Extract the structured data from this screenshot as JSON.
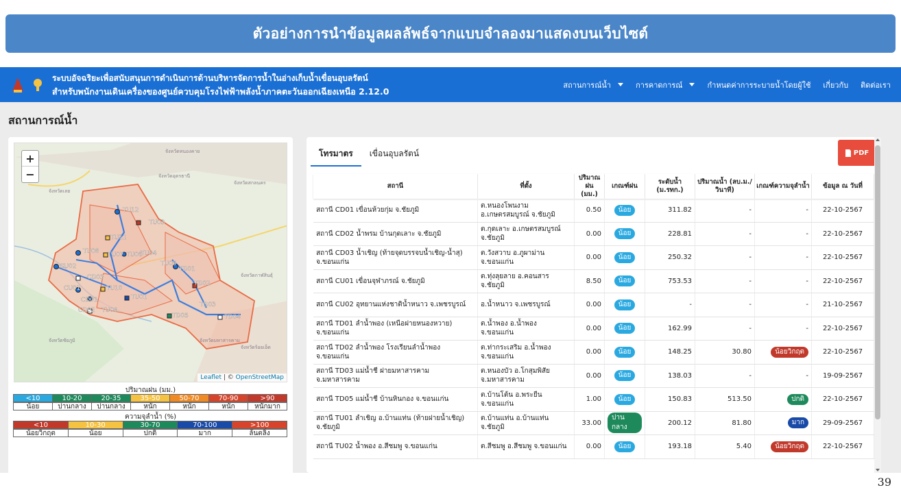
{
  "banner": {
    "title": "ตัวอย่างการนำข้อมูลผลลัพธ์จากแบบจำลองมาแสดงบนเว็บไซต์"
  },
  "navbar": {
    "title_line1": "ระบบอัจฉริยะเพื่อสนับสนุนการดำเนินการด้านบริหารจัดการน้ำในอ่างเก็บน้ำเขื่อนอุบลรัตน์",
    "title_line2": "สำหรับพนักงานเดินเครื่องของศูนย์ควบคุมโรงไฟฟ้าพลังน้ำภาคตะวันออกเฉียงเหนือ 2.12.0",
    "menu": [
      "สถานการณ์น้ำ",
      "การคาดการณ์",
      "กำหนดค่าการระบายน้ำโดยผู้ใช้",
      "เกี่ยวกับ",
      "ติดต่อเรา"
    ]
  },
  "page": {
    "title": "สถานการณ์น้ำ",
    "slide_number": "39"
  },
  "map": {
    "zoom_in": "+",
    "zoom_out": "−",
    "attribution_leaflet": "Leaflet",
    "attribution_sep": " | © ",
    "attribution_osm": "OpenStreetMap",
    "labels": [
      "TU12",
      "TU03",
      "TU11",
      "TU08",
      "TU07",
      "TU06",
      "TU04",
      "CU02",
      "CD03",
      "TU05",
      "TD01",
      "TD02",
      "CU01",
      "TU10",
      "CD01",
      "TU01",
      "TD03",
      "TU09",
      "CD02",
      "TD05",
      "TD04"
    ],
    "place_names": [
      "จังหวัดหนองคาย",
      "จังหวัดเลย",
      "จังหวัดอุดรธานี",
      "จังหวัดสกลนคร",
      "จังหวัดกาฬสินธุ์",
      "จังหวัดชัยภูมิ",
      "จังหวัดมหาสารคาม",
      "จังหวัดร้อยเอ็ด"
    ]
  },
  "legend": {
    "rain_title": "ปริมาณฝน (มม.)",
    "rain_ranges": [
      "<10",
      "10-20",
      "20-35",
      "35-50",
      "50-70",
      "70-90",
      ">90"
    ],
    "rain_labels": [
      "น้อย",
      "ปานกลาง",
      "ปานกลาง",
      "หนัก",
      "หนัก",
      "หนัก",
      "หนักมาก"
    ],
    "rain_colors": [
      "#2aa9e0",
      "#1e8a5c",
      "#1e8a5c",
      "#f5c242",
      "#f08a24",
      "#d6452b",
      "#c0392b"
    ],
    "cap_title": "ความจุลำน้ำ (%)",
    "cap_ranges": [
      "<10",
      "10-30",
      "30-70",
      "70-100",
      ">100"
    ],
    "cap_labels": [
      "น้อยวิกฤต",
      "น้อย",
      "ปกติ",
      "มาก",
      "ล้นตลิ่ง"
    ],
    "cap_colors": [
      "#c0392b",
      "#f5c242",
      "#1e8a5c",
      "#1a4aa8",
      "#d6452b"
    ]
  },
  "tabs": [
    "โทรมาตร",
    "เขื่อนอุบลรัตน์"
  ],
  "pdf_button": "PDF",
  "table": {
    "headers": [
      "สถานี",
      "ที่ตั้ง",
      "ปริมาณฝน (มม.)",
      "เกณฑ์ฝน",
      "ระดับน้ำ (ม.รทก.)",
      "ปริมาณน้ำ (ลบ.ม./วินาที)",
      "เกณฑ์ความจุลำน้ำ",
      "ข้อมูล ณ วันที่"
    ],
    "rows": [
      {
        "station": "สถานี CD01 เขื่อนห้วยกุ่ม จ.ชัยภูมิ",
        "location": "ต.หนองโพนงาม อ.เกษตรสมบูรณ์ จ.ชัยภูมิ",
        "rain": "0.50",
        "rain_level": "น้อย",
        "rain_color": "#2aa9e0",
        "level": "311.82",
        "flow": "-",
        "cap": "-",
        "cap_color": "",
        "date": "22-10-2567"
      },
      {
        "station": "สถานี CD02 น้ำพรม บ้านกุดเลาะ จ.ชัยภูมิ",
        "location": "ต.กุดเลาะ อ.เกษตรสมบูรณ์ จ.ชัยภูมิ",
        "rain": "0.00",
        "rain_level": "น้อย",
        "rain_color": "#2aa9e0",
        "level": "228.81",
        "flow": "-",
        "cap": "-",
        "cap_color": "",
        "date": "22-10-2567"
      },
      {
        "station": "สถานี CD03 น้ำเชิญ (ท้ายจุดบรรจบน้ำเชิญ-น้ำสุ) จ.ขอนแก่น",
        "location": "ต.วังสวาบ อ.ภูผาม่าน จ.ขอนแก่น",
        "rain": "0.00",
        "rain_level": "น้อย",
        "rain_color": "#2aa9e0",
        "level": "250.32",
        "flow": "-",
        "cap": "-",
        "cap_color": "",
        "date": "22-10-2567"
      },
      {
        "station": "สถานี CU01 เขื่อนจุฬาภรณ์ จ.ชัยภูมิ",
        "location": "ต.ทุ่งลุยลาย อ.คอนสาร จ.ชัยภูมิ",
        "rain": "8.50",
        "rain_level": "น้อย",
        "rain_color": "#2aa9e0",
        "level": "753.53",
        "flow": "-",
        "cap": "-",
        "cap_color": "",
        "date": "22-10-2567"
      },
      {
        "station": "สถานี CU02 อุทยานแห่งชาติน้ำหนาว จ.เพชรบูรณ์",
        "location": "อ.น้ำหนาว จ.เพชรบูรณ์",
        "rain": "0.00",
        "rain_level": "น้อย",
        "rain_color": "#2aa9e0",
        "level": "-",
        "flow": "-",
        "cap": "-",
        "cap_color": "",
        "date": "21-10-2567"
      },
      {
        "station": "สถานี TD01 ลำน้ำพอง (เหนือฝายหนองหวาย) จ.ขอนแก่น",
        "location": "ต.น้ำพอง อ.น้ำพอง จ.ขอนแก่น",
        "rain": "0.00",
        "rain_level": "น้อย",
        "rain_color": "#2aa9e0",
        "level": "162.99",
        "flow": "-",
        "cap": "-",
        "cap_color": "",
        "date": "22-10-2567"
      },
      {
        "station": "สถานี TD02 ลำน้ำพอง โรงเรียนลำน้ำพอง จ.ขอนแก่น",
        "location": "ต.ท่ากระเสริม อ.น้ำพอง จ.ขอนแก่น",
        "rain": "0.00",
        "rain_level": "น้อย",
        "rain_color": "#2aa9e0",
        "level": "148.25",
        "flow": "30.80",
        "cap": "น้อยวิกฤต",
        "cap_color": "#c0392b",
        "date": "22-10-2567"
      },
      {
        "station": "สถานี TD03 แม่น้ำชี ฝายมหาสารคาม จ.มหาสารคาม",
        "location": "ต.หนองบัว อ.โกสุมพิสัย จ.มหาสารคาม",
        "rain": "0.00",
        "rain_level": "น้อย",
        "rain_color": "#2aa9e0",
        "level": "138.03",
        "flow": "-",
        "cap": "-",
        "cap_color": "",
        "date": "19-09-2567"
      },
      {
        "station": "สถานี TD05 แม่น้ำชี บ้านหินกอง จ.ขอนแก่น",
        "location": "ต.บ้านโต้น อ.พระยืน จ.ขอนแก่น",
        "rain": "1.00",
        "rain_level": "น้อย",
        "rain_color": "#2aa9e0",
        "level": "150.83",
        "flow": "513.50",
        "cap": "ปกติ",
        "cap_color": "#1e8a5c",
        "date": "22-10-2567"
      },
      {
        "station": "สถานี TU01 ลำเชิญ อ.บ้านแท่น (ท้ายฝายน้ำเชิญ) จ.ชัยภูมิ",
        "location": "ต.บ้านแท่น อ.บ้านแท่น จ.ชัยภูมิ",
        "rain": "33.00",
        "rain_level": "ปานกลาง",
        "rain_color": "#1e8a5c",
        "level": "200.12",
        "flow": "81.80",
        "cap": "มาก",
        "cap_color": "#1a4aa8",
        "date": "29-09-2567"
      },
      {
        "station": "สถานี TU02 น้ำพอง อ.สีชมพู จ.ขอนแก่น",
        "location": "ต.สีชมพู อ.สีชมพู จ.ขอนแก่น",
        "rain": "0.00",
        "rain_level": "น้อย",
        "rain_color": "#2aa9e0",
        "level": "193.18",
        "flow": "5.40",
        "cap": "น้อยวิกฤต",
        "cap_color": "#c0392b",
        "date": "22-10-2567"
      }
    ]
  }
}
